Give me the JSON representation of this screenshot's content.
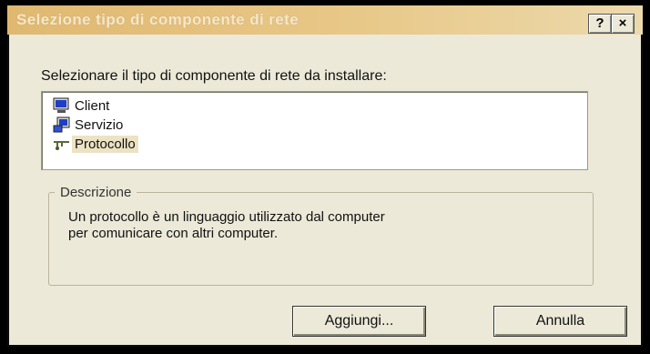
{
  "dialog": {
    "title": "Selezione tipo di componente di rete",
    "help_label": "?",
    "close_label": "×"
  },
  "prompt": "Selezionare il tipo di componente di rete da installare:",
  "components": [
    {
      "label": "Client",
      "icon": "client-icon"
    },
    {
      "label": "Servizio",
      "icon": "service-icon"
    },
    {
      "label": "Protocollo",
      "icon": "protocol-icon",
      "selected": true
    }
  ],
  "description": {
    "group_label": "Descrizione",
    "text_line1": "Un protocollo è un linguaggio utilizzato dal computer",
    "text_line2": "per comunicare con altri computer."
  },
  "buttons": {
    "add_label": "Aggiungi...",
    "cancel_label": "Annulla"
  }
}
